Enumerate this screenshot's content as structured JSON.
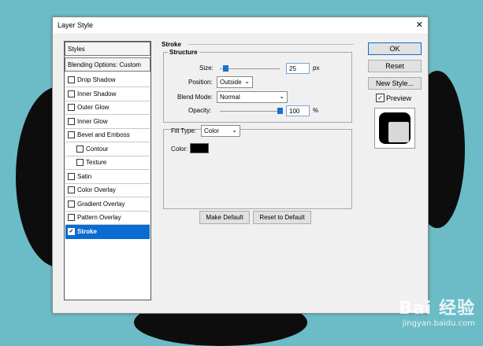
{
  "dialog": {
    "title": "Layer Style",
    "close_glyph": "✕"
  },
  "left": {
    "styles_header": "Styles",
    "blending_options": "Blending Options: Custom",
    "items": [
      {
        "label": "Drop Shadow",
        "checked": false,
        "indent": false
      },
      {
        "label": "Inner Shadow",
        "checked": false,
        "indent": false
      },
      {
        "label": "Outer Glow",
        "checked": false,
        "indent": false
      },
      {
        "label": "Inner Glow",
        "checked": false,
        "indent": false
      },
      {
        "label": "Bevel and Emboss",
        "checked": false,
        "indent": false
      },
      {
        "label": "Contour",
        "checked": false,
        "indent": true
      },
      {
        "label": "Texture",
        "checked": false,
        "indent": true
      },
      {
        "label": "Satin",
        "checked": false,
        "indent": false
      },
      {
        "label": "Color Overlay",
        "checked": false,
        "indent": false
      },
      {
        "label": "Gradient Overlay",
        "checked": false,
        "indent": false
      },
      {
        "label": "Pattern Overlay",
        "checked": false,
        "indent": false
      },
      {
        "label": "Stroke",
        "checked": true,
        "indent": false,
        "selected": true
      }
    ]
  },
  "main": {
    "section_title": "Stroke",
    "structure_title": "Structure",
    "size_label": "Size:",
    "size_value": "25",
    "size_unit": "px",
    "position_label": "Position:",
    "position_value": "Outside",
    "blend_mode_label": "Blend Mode:",
    "blend_mode_value": "Normal",
    "opacity_label": "Opacity:",
    "opacity_value": "100",
    "opacity_unit": "%",
    "fill_type_label": "Fill Type:",
    "fill_type_value": "Color",
    "color_label": "Color:",
    "stroke_color": "#000000",
    "make_default": "Make Default",
    "reset_to_default": "Reset to Default"
  },
  "right": {
    "ok": "OK",
    "reset": "Reset",
    "new_style": "New Style...",
    "preview_label": "Preview",
    "preview_checked": true
  },
  "watermark": {
    "brand": "Bai 经验",
    "url": "jingyan.baidu.com"
  }
}
